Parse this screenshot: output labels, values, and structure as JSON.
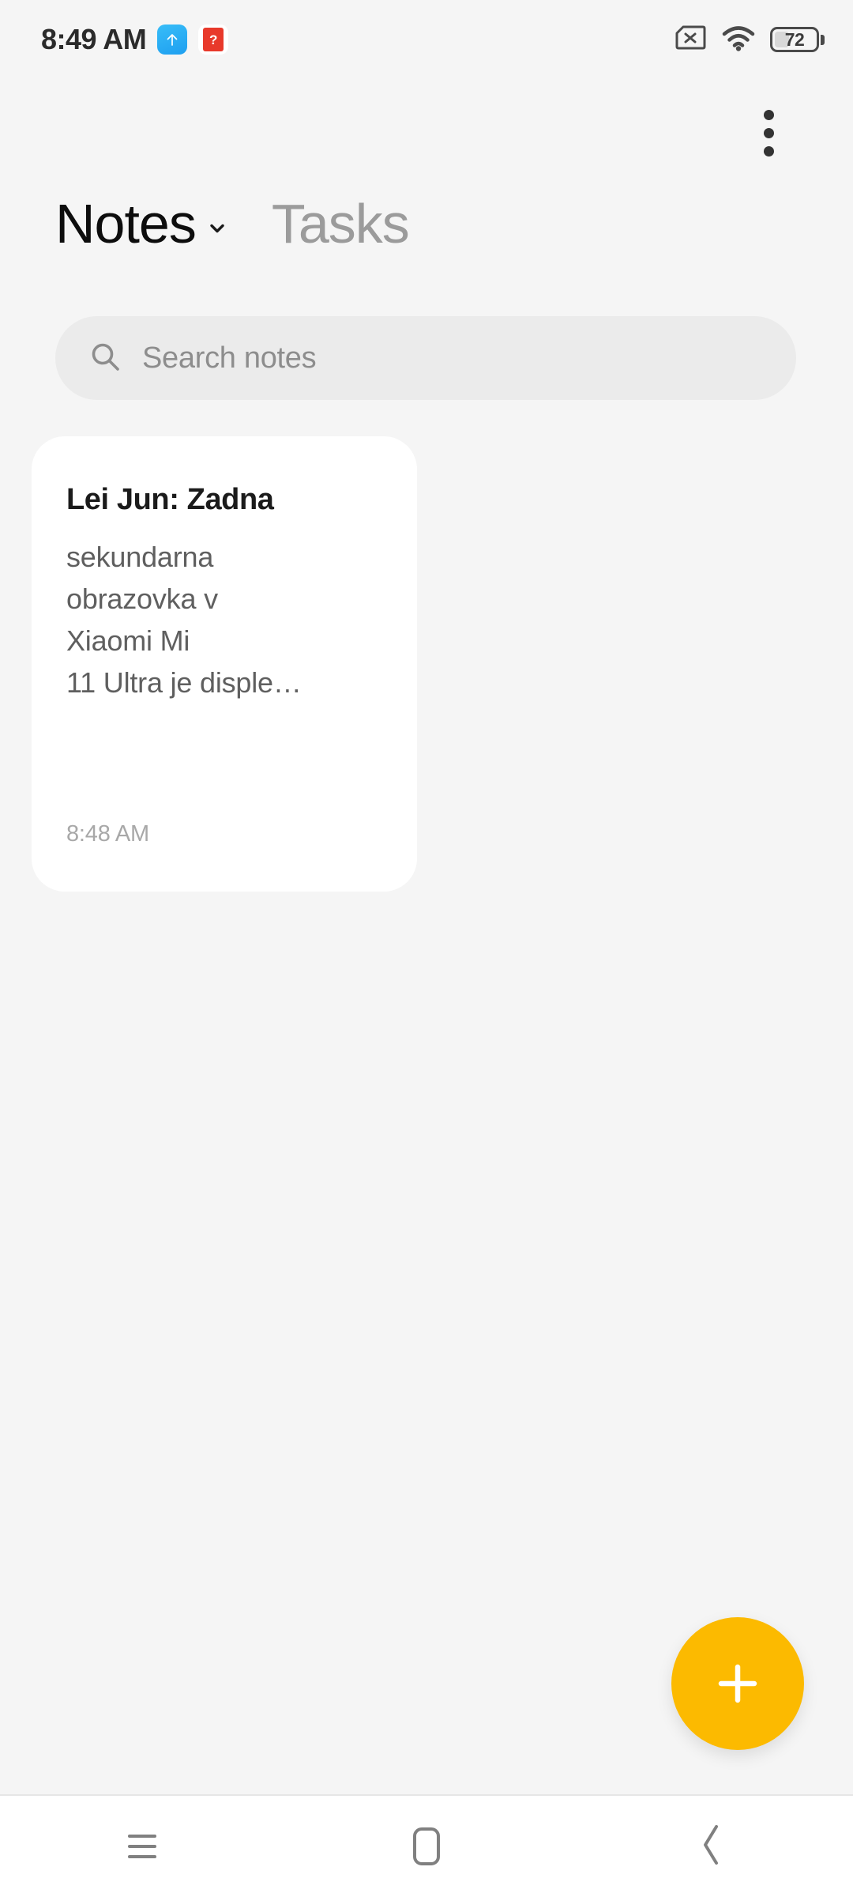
{
  "status_bar": {
    "clock": "8:49 AM",
    "icons_left": [
      {
        "name": "upload-arrow-icon",
        "glyph": "↑"
      },
      {
        "name": "miui-notification-icon",
        "glyph": "?"
      }
    ],
    "icons_right": [
      {
        "name": "no-sim-icon"
      },
      {
        "name": "wifi-icon"
      },
      {
        "name": "battery-icon"
      }
    ],
    "battery_level": "72"
  },
  "header": {
    "overflow_menu": "more-options",
    "tabs": [
      {
        "label": "Notes",
        "active": true,
        "has_dropdown": true
      },
      {
        "label": "Tasks",
        "active": false,
        "has_dropdown": false
      }
    ]
  },
  "search": {
    "placeholder": "Search notes",
    "value": "",
    "icon": "search-icon"
  },
  "notes": [
    {
      "title": "Lei Jun: Zadna",
      "body": "sekundarna\nobrazovka v\nXiaomi Mi\n11 Ultra je disple…",
      "time": "8:48 AM"
    }
  ],
  "fab": {
    "label": "+",
    "action": "add-note",
    "color": "#fcba00"
  },
  "nav_bar": {
    "buttons": [
      {
        "name": "recents",
        "icon": "recents-icon"
      },
      {
        "name": "home",
        "icon": "home-icon"
      },
      {
        "name": "back",
        "icon": "back-chevron-icon"
      }
    ]
  },
  "colors": {
    "background": "#f5f5f5",
    "card": "#ffffff",
    "search_field": "#ebebeb",
    "accent": "#fcba00",
    "text_primary": "#0d0d0d",
    "text_secondary": "#5f5f5f",
    "text_muted": "#9b9b9b"
  }
}
